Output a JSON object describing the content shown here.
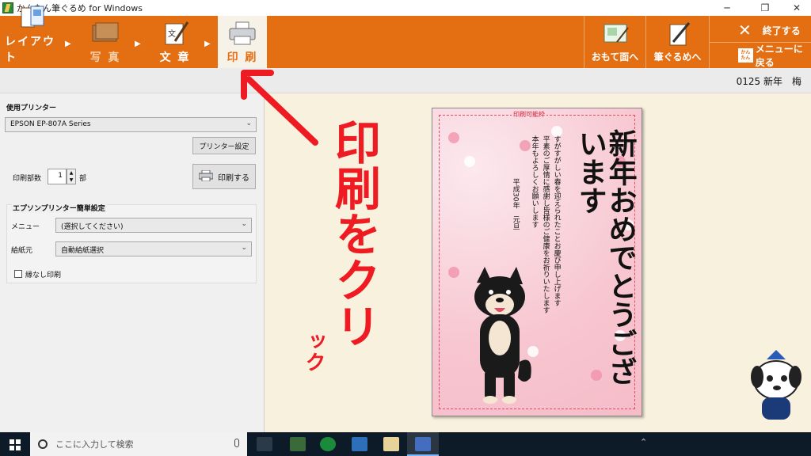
{
  "window": {
    "title": "かんたん筆ぐるめ for Windows",
    "minimize": "─",
    "maximize": "❐",
    "close": "✕"
  },
  "tabs": [
    {
      "label": "レイアウト"
    },
    {
      "label": "写 真"
    },
    {
      "label": "文 章"
    },
    {
      "label": "印 刷"
    }
  ],
  "toolbar_right": {
    "omote": "おもて面へ",
    "fudegurume": "筆ぐるめへ",
    "quit": "終了する",
    "menu": "メニューに戻る",
    "menu_badge": "かんたん"
  },
  "document": {
    "name": "0125 新年　梅"
  },
  "printer": {
    "label": "使用プリンター",
    "selected": "EPSON EP-807A Series",
    "settings_button": "プリンター設定",
    "copies_label": "印刷部数",
    "copies_value": "1",
    "copies_unit": "部",
    "print_button": "印刷する"
  },
  "epson": {
    "group_label": "エプソンプリンター簡単設定",
    "menu_label": "メニュー",
    "menu_value": "(選択してください)",
    "feed_label": "給紙元",
    "feed_value": "自動給紙選択",
    "borderless_label": "縁なし印刷"
  },
  "card": {
    "frame_label": "印刷可能枠",
    "heading": "新年おめでとうございます",
    "message_lines": [
      "すがすがしい春を迎えられたことお慶び申し上げます",
      "平素のご厚情に感謝し皆様のご健康をお祈りいたします",
      "本年もよろしくお願いします"
    ],
    "date": "平成30年　元旦"
  },
  "annotation": {
    "main": "印刷をクリ",
    "small": "ック"
  },
  "taskbar": {
    "search_placeholder": "ここに入力して検索"
  }
}
